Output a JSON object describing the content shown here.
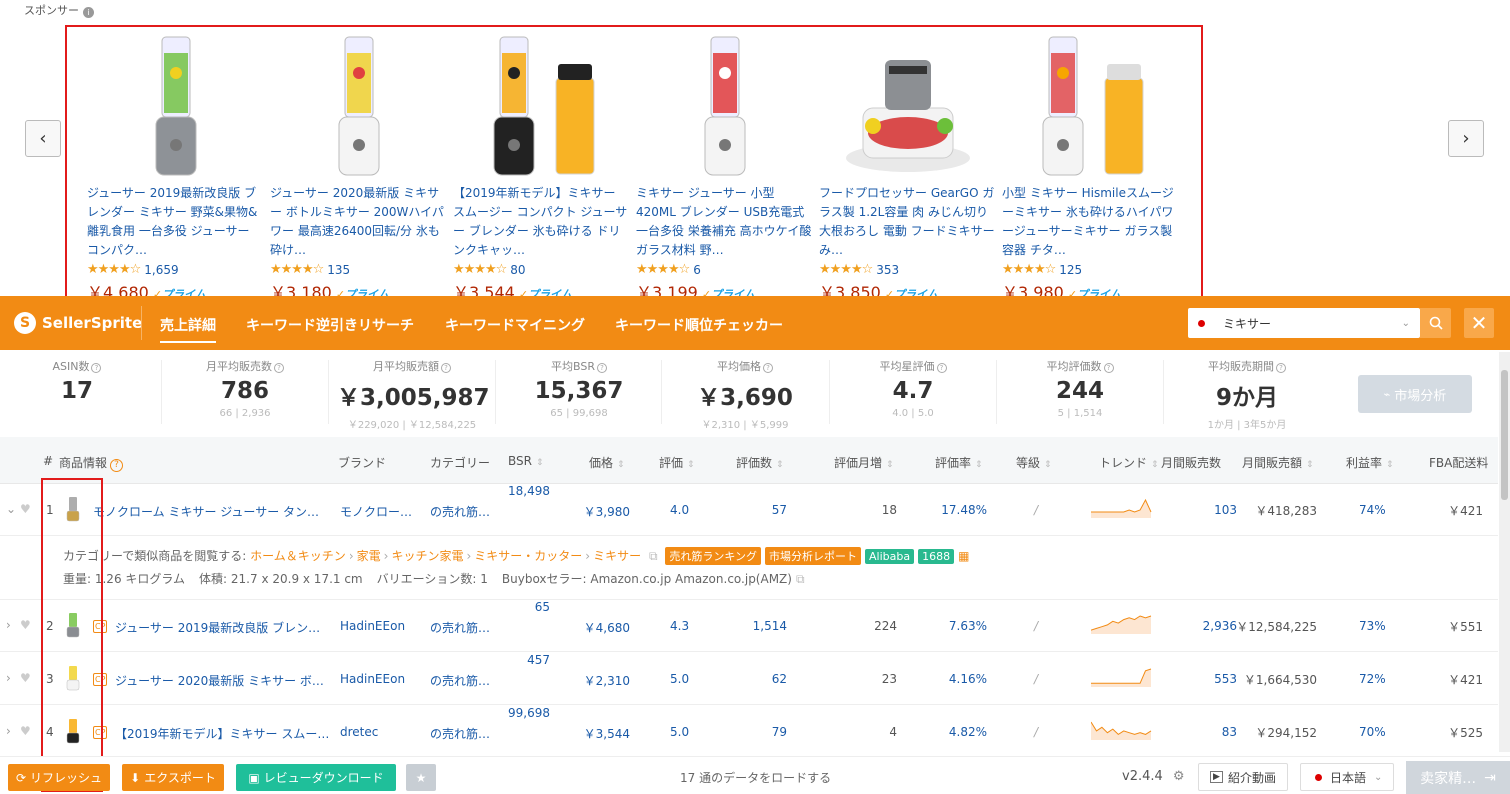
{
  "sponsor": {
    "label": "スポンサー",
    "cards": [
      {
        "title": "ジューサー 2019最新改良版 ブレンダー ミキサー 野菜&果物&離乳食用 一台多役 ジューサー コンパク…",
        "stars": "★★★★☆",
        "count": "1,659",
        "price": "￥4,680",
        "prime": "プライム",
        "img": "blender-icon"
      },
      {
        "title": "ジューサー 2020最新版 ミキサー ボトルミキサー 200Wハイパワー 最高速26400回転/分 氷も砕け…",
        "stars": "★★★★☆",
        "count": "135",
        "price": "￥3,180",
        "prime": "プライム",
        "img": "blender-icon"
      },
      {
        "title": "【2019年新モデル】ミキサー スムージー コンパクト ジューサー ブレンダー 氷も砕ける ドリンクキャッ…",
        "stars": "★★★★☆",
        "count": "80",
        "price": "￥3,544",
        "prime": "プライム",
        "img": "blender-icon"
      },
      {
        "title": "ミキサー ジューサー 小型 420ML ブレンダー USB充電式 一台多役 栄養補充 高ホウケイ酸ガラス材料 野…",
        "stars": "★★★★☆",
        "count": "6",
        "price": "￥3,199",
        "prime": "プライム",
        "img": "blender-icon"
      },
      {
        "title": "フードプロセッサー GearGO ガラス製 1.2L容量 肉 みじん切り 大根おろし 電動 フードミキサー み…",
        "stars": "★★★★☆",
        "count": "353",
        "price": "￥3,850",
        "prime": "プライム",
        "img": "food-processor-icon"
      },
      {
        "title": "小型 ミキサー Hismileスムージーミキサー 氷も砕けるハイパワージューサーミキサー ガラス製容器 チタ…",
        "stars": "★★★★☆",
        "count": "125",
        "price": "￥3,980",
        "prime": "プライム",
        "img": "blender-icon"
      }
    ]
  },
  "header": {
    "logo": "SellerSprite",
    "tabs": [
      "売上詳細",
      "キーワード逆引きリサーチ",
      "キーワードマイニング",
      "キーワード順位チェッカー"
    ],
    "search_value": "ミキサー"
  },
  "stats": [
    {
      "label": "ASIN数",
      "value": "17",
      "range": ""
    },
    {
      "label": "月平均販売数",
      "value": "786",
      "range": "66 | 2,936"
    },
    {
      "label": "月平均販売額",
      "value": "￥3,005,987",
      "range": "￥229,020 | ￥12,584,225"
    },
    {
      "label": "平均BSR",
      "value": "15,367",
      "range": "65 | 99,698"
    },
    {
      "label": "平均価格",
      "value": "￥3,690",
      "range": "￥2,310 | ￥5,999"
    },
    {
      "label": "平均星評価",
      "value": "4.7",
      "range": "4.0 | 5.0"
    },
    {
      "label": "平均評価数",
      "value": "244",
      "range": "5 | 1,514"
    },
    {
      "label": "平均販売期間",
      "value": "9か月",
      "range": "1か月 | 3年5か月"
    }
  ],
  "market_button": "市場分析",
  "table": {
    "headers": {
      "num": "#",
      "product": "商品情報",
      "brand": "ブランド",
      "category": "カテゴリー",
      "bsr": "BSR",
      "price": "価格",
      "rating": "評価",
      "reviews": "評価数",
      "monthly_reviews": "評価月増",
      "review_rate": "評価率",
      "grade": "等級",
      "trend": "トレンド",
      "monthly_sales": "月間販売数",
      "monthly_revenue": "月間販売額",
      "margin": "利益率",
      "fba": "FBA配送料"
    },
    "rows": [
      {
        "num": "1",
        "title": "モノクローム ミキサー ジューサー タン…",
        "brand": "モノクロー…",
        "category": "の売れ筋…",
        "bsr": "18,498",
        "price": "￥3,980",
        "rating": "4.0",
        "reviews": "57",
        "monthly_reviews": "18",
        "review_rate": "17.48%",
        "grade": "/",
        "sales": "103",
        "revenue": "￥418,283",
        "margin": "74%",
        "fba": "￥421",
        "trend": [
          2,
          2,
          2,
          2,
          2,
          2,
          2,
          3,
          2,
          3,
          8,
          2
        ]
      },
      {
        "num": "2",
        "title": "ジューサー 2019最新改良版 ブレン…",
        "brand": "HadinEEon",
        "category": "の売れ筋…",
        "bsr": "65",
        "price": "￥4,680",
        "rating": "4.3",
        "reviews": "1,514",
        "monthly_reviews": "224",
        "review_rate": "7.63%",
        "grade": "/",
        "sales": "2,936",
        "revenue": "￥12,584,225",
        "margin": "73%",
        "fba": "￥551",
        "trend": [
          1,
          2,
          3,
          4,
          6,
          5,
          7,
          8,
          7,
          9,
          8,
          9
        ]
      },
      {
        "num": "3",
        "title": "ジューサー 2020最新版 ミキサー ボ…",
        "brand": "HadinEEon",
        "category": "の売れ筋…",
        "bsr": "457",
        "price": "￥2,310",
        "rating": "5.0",
        "reviews": "62",
        "monthly_reviews": "23",
        "review_rate": "4.16%",
        "grade": "/",
        "sales": "553",
        "revenue": "￥1,664,530",
        "margin": "72%",
        "fba": "￥421",
        "trend": [
          1,
          1,
          1,
          1,
          1,
          1,
          1,
          1,
          1,
          1,
          8,
          9
        ]
      },
      {
        "num": "4",
        "title": "【2019年新モデル】ミキサー スムー…",
        "brand": "dretec",
        "category": "の売れ筋…",
        "bsr": "99,698",
        "price": "￥3,544",
        "rating": "5.0",
        "reviews": "79",
        "monthly_reviews": "4",
        "review_rate": "4.82%",
        "grade": "/",
        "sales": "83",
        "revenue": "￥294,152",
        "margin": "70%",
        "fba": "￥525",
        "trend": [
          9,
          4,
          6,
          3,
          5,
          2,
          4,
          3,
          2,
          3,
          2,
          4
        ]
      }
    ],
    "detail": {
      "browse_label": "カテゴリーで類似商品を閲覧する:",
      "crumbs": [
        "ホーム＆キッチン",
        "家電",
        "キッチン家電",
        "ミキサー・カッター",
        "ミキサー"
      ],
      "tags": [
        "売れ筋ランキング",
        "市場分析レポート",
        "Alibaba",
        "1688"
      ],
      "weight": "重量: 1.26 キログラム",
      "size": "体積: 21.7 x 20.9 x 17.1 cm",
      "variations": "バリエーション数: 1",
      "buybox": "Buyboxセラー: Amazon.co.jp Amazon.co.jp(AMZ)"
    }
  },
  "footer": {
    "refresh": "リフレッシュ",
    "export": "エクスポート",
    "review_download": "レビューダウンロード",
    "status": "17 通のデータをロードする",
    "version": "v2.4.4",
    "video": "紹介動画",
    "language": "日本語",
    "seller": "卖家精…"
  }
}
